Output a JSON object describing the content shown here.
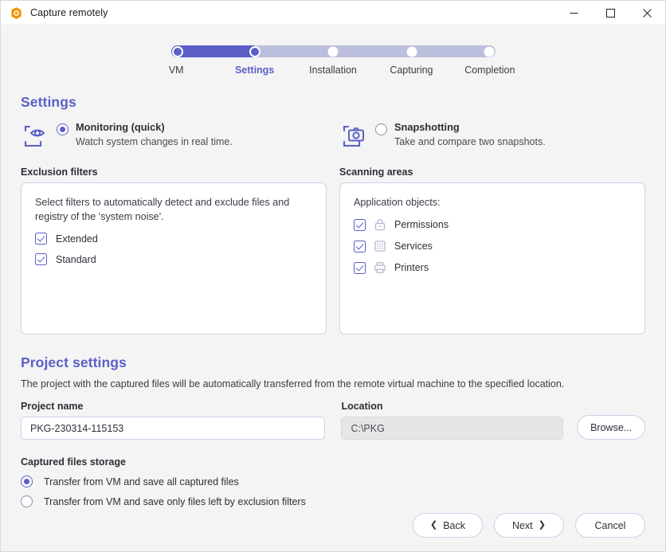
{
  "window": {
    "title": "Capture remotely",
    "logo_icon": "app-logo-icon",
    "minimize_label": "Minimize",
    "maximize_label": "Maximize",
    "close_label": "Close"
  },
  "stepper": {
    "current_index": 1,
    "steps": [
      {
        "label": "VM",
        "state": "done"
      },
      {
        "label": "Settings",
        "state": "current"
      },
      {
        "label": "Installation",
        "state": "pending"
      },
      {
        "label": "Capturing",
        "state": "pending"
      },
      {
        "label": "Completion",
        "state": "pending"
      }
    ]
  },
  "settings": {
    "heading": "Settings",
    "modes": [
      {
        "name": "Monitoring (quick)",
        "description": "Watch system changes in real time.",
        "icon": "eye-frame-icon",
        "selected": true
      },
      {
        "name": "Snapshotting",
        "description": "Take and compare two snapshots.",
        "icon": "camera-frame-icon",
        "selected": false
      }
    ],
    "exclusion": {
      "label": "Exclusion filters",
      "description": "Select filters to automatically detect and exclude files and registry of the 'system noise'.",
      "items": [
        {
          "label": "Extended",
          "checked": true
        },
        {
          "label": "Standard",
          "checked": true
        }
      ]
    },
    "scanning": {
      "label": "Scanning areas",
      "description": "Application objects:",
      "items": [
        {
          "label": "Permissions",
          "checked": true,
          "icon": "lock-icon"
        },
        {
          "label": "Services",
          "checked": true,
          "icon": "grid-services-icon"
        },
        {
          "label": "Printers",
          "checked": true,
          "icon": "printer-icon"
        }
      ]
    }
  },
  "project": {
    "heading": "Project settings",
    "description": "The project with the captured files will be automatically transferred from the remote virtual machine to the specified location.",
    "name_label": "Project name",
    "name_value": "PKG-230314-115153",
    "location_label": "Location",
    "location_value": "C:\\PKG",
    "browse_label": "Browse...",
    "storage_label": "Captured files storage",
    "storage_options": [
      {
        "label": "Transfer from VM and save all captured files",
        "selected": true
      },
      {
        "label": "Transfer from VM and save only files left by exclusion filters",
        "selected": false
      }
    ]
  },
  "footer": {
    "back_label": "Back",
    "next_label": "Next",
    "cancel_label": "Cancel",
    "back_icon": "chevron-left-icon",
    "next_icon": "chevron-right-icon"
  },
  "colors": {
    "accent": "#5b5fc7",
    "track": "#bcbedd",
    "background": "#f4f4f4",
    "panel_border": "#cfd0e8",
    "logo_orange": "#f29100"
  }
}
